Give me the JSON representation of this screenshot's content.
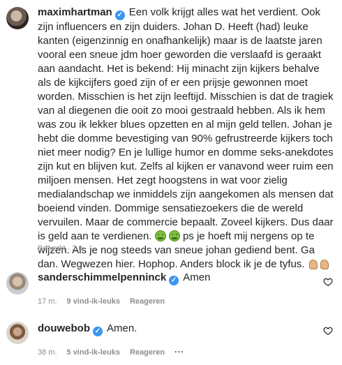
{
  "main_comment": {
    "username": "maximhartman",
    "text_part1": "Een volk krijgt alles wat het verdient. Ook zijn influencers en zijn duiders. Johan D. Heeft (had) leuke kanten (eigenzinnig en onafhankelijk) maar is de laatste jaren vooral een sneue jdm hoer geworden die verslaafd is geraakt aan aandacht. Het is bekend: Hij minacht zijn kijkers behalve als de kijkcijfers goed zijn of er een prijsje gewonnen moet worden. Misschien is het zijn leeftijd. Misschien is dat de tragiek van al diegenen die ooit zo mooi gestraald hebben. Als ik hem was zou ik lekker blues opzetten en al mijn geld tellen. Johan je hebt die domme bevestiging van 90% gefrustreerde kijkers toch niet meer nodig? En je lullige humor en domme seks-anekdotes zijn kut en blijven kut. Zelfs al kijken er vanavond weer ruim een miljoen mensen. Het zegt hoogstens in wat voor zielig medialandschap we inmiddels zijn aangekomen als mensen dat boeiend vinden. Dommige sensatiezoekers die de wereld vervuilen. Maar de commercie bepaalt. Zoveel kijkers. Dus daar is geld aan te verdienen.",
    "text_part2": "ps je hoeft mij nergens op te wijzen. Als je nog steeds van sneue johan gediend bent. Ga dan. Wegwezen hier. Hophop. Anders block ik je de tyfus.",
    "meta": {
      "edited": "Bewerkt · 2 u."
    }
  },
  "replies": [
    {
      "username": "sanderschimmelpenninck",
      "text": "Amen",
      "time": "17 m.",
      "likes": "9 vind-ik-leuks",
      "reply_label": "Reageren"
    },
    {
      "username": "douwebob",
      "text": "Amen.",
      "time": "38 m.",
      "likes": "5 vind-ik-leuks",
      "reply_label": "Reageren",
      "more": "···"
    }
  ],
  "icons": {
    "verified": "verified-badge-icon",
    "heart": "heart-outline-icon"
  },
  "colors": {
    "verified": "#3897f0",
    "meta_gray": "#8e8e8e",
    "text": "#262626"
  }
}
